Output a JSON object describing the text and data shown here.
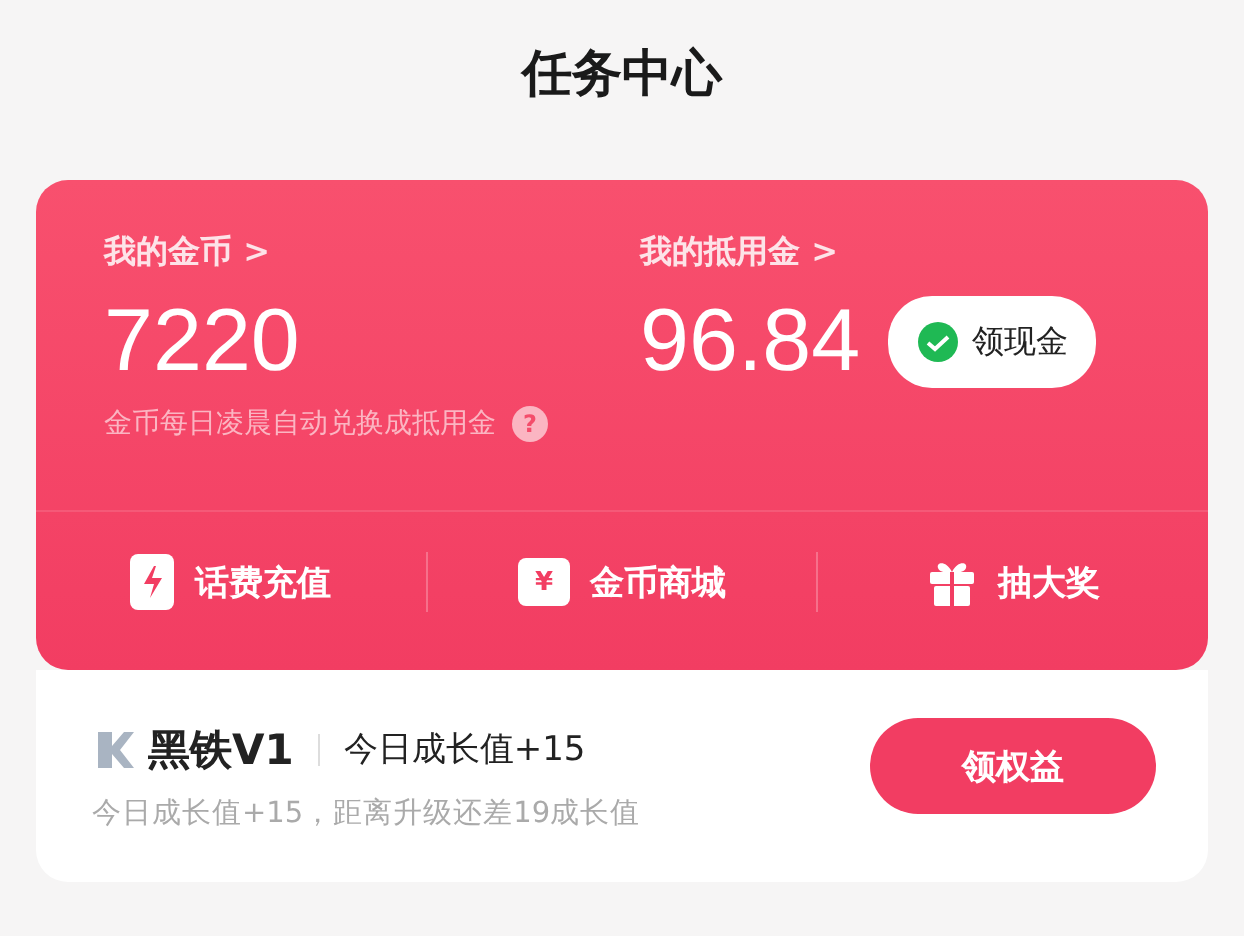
{
  "header": {
    "title": "任务中心"
  },
  "wallet": {
    "stats": [
      {
        "label": "我的金币",
        "arrow": ">",
        "value": "7220"
      },
      {
        "label": "我的抵用金",
        "arrow": ">",
        "value": "96.84",
        "action": "领现金"
      }
    ],
    "hint": "金币每日凌晨自动兑换成抵用金",
    "hint_icon": "?",
    "shortcuts": [
      {
        "kind": "bolt",
        "label": "话费充值"
      },
      {
        "kind": "ticket",
        "label": "金币商城",
        "icon_text": "¥"
      },
      {
        "kind": "gift",
        "label": "抽大奖"
      }
    ]
  },
  "level_card": {
    "level": "黑铁V1",
    "today": "今日成长值+15",
    "progress": "今日成长值+15，距离升级还差19成长值",
    "button": "领权益"
  }
}
